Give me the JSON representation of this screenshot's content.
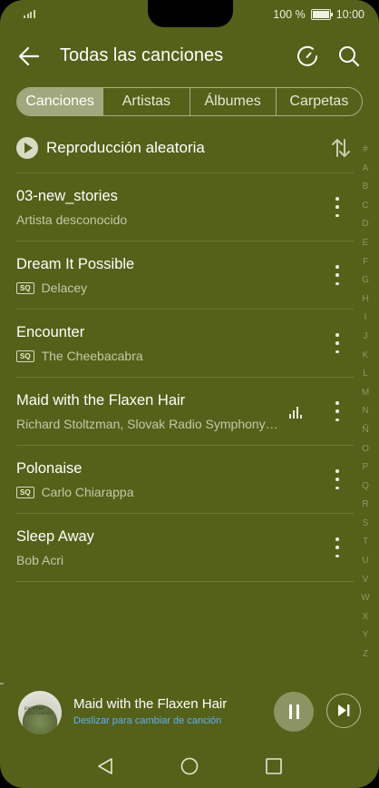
{
  "status_bar": {
    "battery": "100 %",
    "time": "10:00"
  },
  "header": {
    "title": "Todas las canciones"
  },
  "tabs": [
    {
      "label": "Canciones"
    },
    {
      "label": "Artistas"
    },
    {
      "label": "Álbumes"
    },
    {
      "label": "Carpetas"
    }
  ],
  "shuffle": {
    "label": "Reproducción aleatoria"
  },
  "songs": [
    {
      "title": "03-new_stories",
      "artist": "Artista desconocido",
      "sq": false,
      "playing": false
    },
    {
      "title": "Dream It Possible",
      "artist": "Delacey",
      "sq": true,
      "playing": false
    },
    {
      "title": "Encounter",
      "artist": "The Cheebacabra",
      "sq": true,
      "playing": false
    },
    {
      "title": "Maid with the Flaxen Hair",
      "artist": "Richard Stoltzman, Slovak Radio Symphony Orchestra",
      "sq": false,
      "playing": true
    },
    {
      "title": "Polonaise",
      "artist": "Carlo Chiarappa",
      "sq": true,
      "playing": false
    },
    {
      "title": "Sleep Away",
      "artist": "Bob Acri",
      "sq": false,
      "playing": false
    }
  ],
  "sq_badge": "SQ",
  "alpha_index": [
    "#",
    "A",
    "B",
    "C",
    "D",
    "E",
    "F",
    "G",
    "H",
    "I",
    "J",
    "K",
    "L",
    "M",
    "N",
    "Ñ",
    "O",
    "P",
    "Q",
    "R",
    "S",
    "T",
    "U",
    "V",
    "W",
    "X",
    "Y",
    "Z"
  ],
  "now_playing": {
    "title": "Maid with the Flaxen Hair",
    "hint": "Deslizar para cambiar de canción",
    "art_text": "RICHARD STOLTZMAN"
  },
  "colors": {
    "background": "#556019",
    "accent_link": "#5ab0ff"
  }
}
